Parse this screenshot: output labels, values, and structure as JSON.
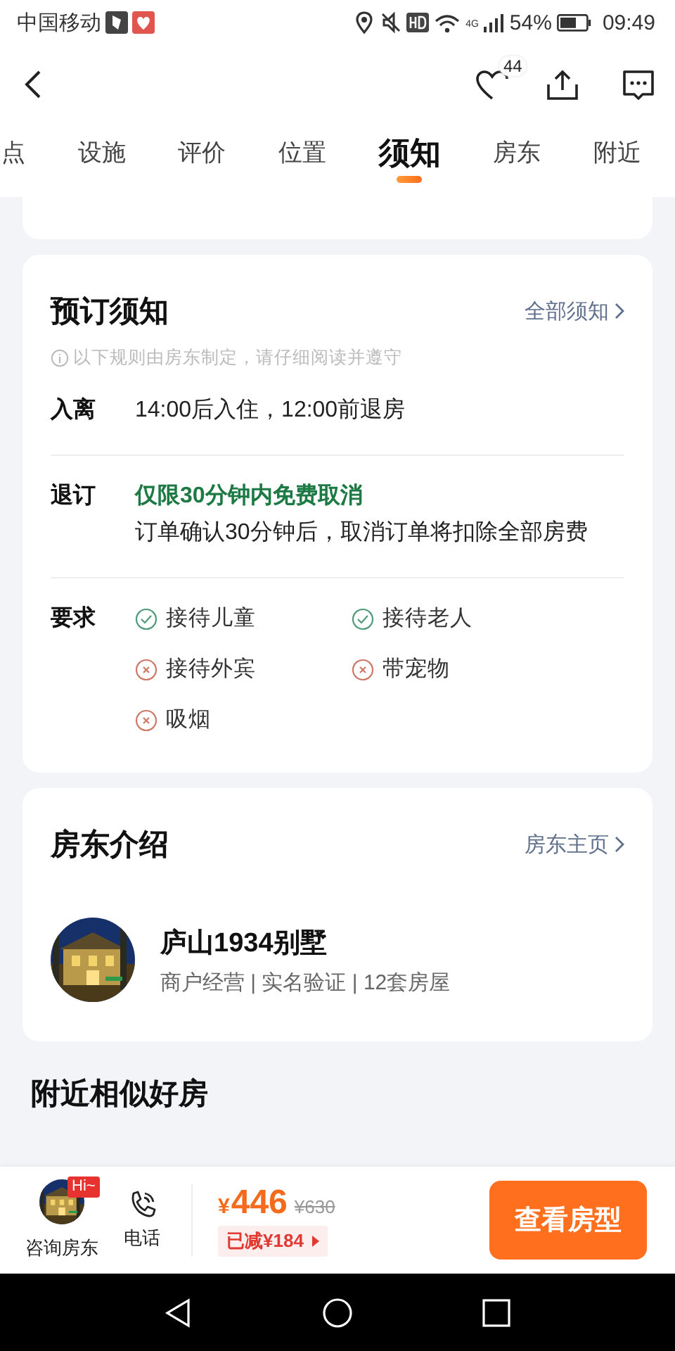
{
  "status_bar": {
    "carrier": "中国移动",
    "network": "4G",
    "battery": "54%",
    "time": "09:49"
  },
  "nav_bar": {
    "like_count": "44"
  },
  "tabs": [
    {
      "label": "点",
      "selected": false
    },
    {
      "label": "设施",
      "selected": false
    },
    {
      "label": "评价",
      "selected": false
    },
    {
      "label": "位置",
      "selected": false
    },
    {
      "label": "须知",
      "selected": true
    },
    {
      "label": "房东",
      "selected": false
    },
    {
      "label": "附近",
      "selected": false
    }
  ],
  "booking_notice": {
    "title": "预订须知",
    "link": "全部须知",
    "hint": "以下规则由房东制定，请仔细阅读并遵守",
    "rows": [
      {
        "kind": "text",
        "label": "入离",
        "text": "14:00后入住，12:00前退房"
      },
      {
        "kind": "cancel",
        "label": "退订",
        "highlight": "仅限30分钟内免费取消",
        "text": "订单确认30分钟后，取消订单将扣除全部房费"
      },
      {
        "kind": "rules",
        "label": "要求",
        "items": [
          {
            "text": "接待儿童",
            "allowed": true
          },
          {
            "text": "接待老人",
            "allowed": true
          },
          {
            "text": "接待外宾",
            "allowed": false
          },
          {
            "text": "带宠物",
            "allowed": false
          },
          {
            "text": "吸烟",
            "allowed": false
          }
        ]
      }
    ]
  },
  "host": {
    "title": "房东介绍",
    "link": "房东主页",
    "name": "庐山1934别墅",
    "info": "商户经营 | 实名验证 | 12套房屋"
  },
  "nearby": {
    "title": "附近相似好房"
  },
  "bottom_bar": {
    "consult_label": "咨询房东",
    "badge": "Hi~",
    "phone_label": "电话",
    "currency": "¥",
    "price": "446",
    "original_price": "¥630",
    "discount": "已减¥184",
    "cta": "查看房型"
  }
}
